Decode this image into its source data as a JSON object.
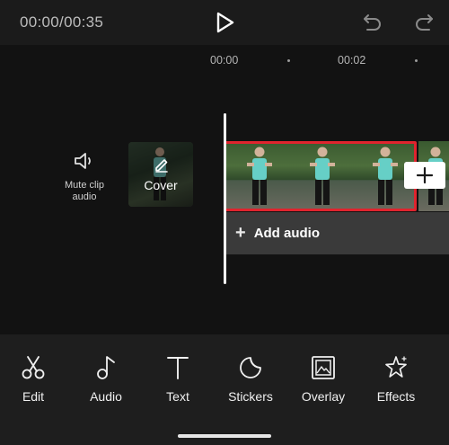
{
  "header": {
    "time": "00:00/00:35",
    "play_icon": "play-icon",
    "undo_icon": "undo-icon",
    "redo_icon": "redo-icon"
  },
  "ruler": {
    "labels": [
      "00:00",
      "00:02"
    ]
  },
  "timeline": {
    "mute_label": "Mute clip audio",
    "mute_icon": "speaker-icon",
    "cover_label": "Cover",
    "cover_icon": "pencil-icon",
    "add_clip_icon": "plus-icon",
    "add_audio_plus": "+",
    "add_audio_label": "Add audio",
    "selection_color": "#e0242e"
  },
  "toolbar": {
    "items": [
      {
        "label": "Edit",
        "icon": "scissors-icon"
      },
      {
        "label": "Audio",
        "icon": "music-note-icon"
      },
      {
        "label": "Text",
        "icon": "text-icon"
      },
      {
        "label": "Stickers",
        "icon": "sticker-icon"
      },
      {
        "label": "Overlay",
        "icon": "overlay-icon"
      },
      {
        "label": "Effects",
        "icon": "effects-star-icon"
      }
    ]
  }
}
